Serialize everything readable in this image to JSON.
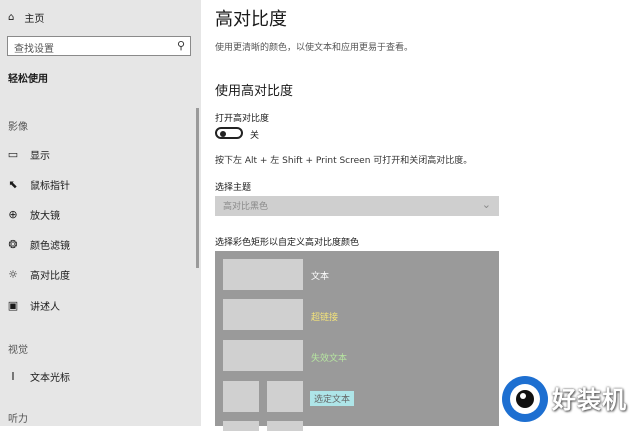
{
  "sidebar": {
    "home_label": "主页",
    "search_placeholder": "查找设置",
    "title": "轻松使用",
    "sections": {
      "vision": "影像",
      "video": "视觉",
      "hearing": "听力"
    },
    "items": [
      {
        "label": "显示",
        "icon": "monitor-icon"
      },
      {
        "label": "鼠标指针",
        "icon": "mouse-pointer-icon"
      },
      {
        "label": "放大镜",
        "icon": "magnifier-icon"
      },
      {
        "label": "颜色滤镜",
        "icon": "color-filter-icon"
      },
      {
        "label": "高对比度",
        "icon": "contrast-icon"
      },
      {
        "label": "讲述人",
        "icon": "narrator-icon"
      },
      {
        "label": "文本光标",
        "icon": "text-cursor-icon"
      }
    ]
  },
  "main": {
    "title": "高对比度",
    "description": "使用更清晰的颜色，以使文本和应用更易于查看。",
    "section_title": "使用高对比度",
    "toggle_label": "打开高对比度",
    "toggle_state": "关",
    "shortcut_hint": "按下左 Alt + 左 Shift + Print Screen 可打开和关闭高对比度。",
    "theme_label": "选择主题",
    "theme_value": "高对比黑色",
    "preview_label": "选择彩色矩形以自定义高对比度颜色",
    "preview": {
      "text": "文本",
      "hyperlink": "超链接",
      "disabled_text": "失效文本",
      "selected_text": "选定文本"
    }
  },
  "colors": {
    "hyperlink": "#f2e27a",
    "disabled_text": "#b6e5a0",
    "selected_bg": "#aee5e8"
  },
  "watermark": {
    "text": "好装机"
  }
}
